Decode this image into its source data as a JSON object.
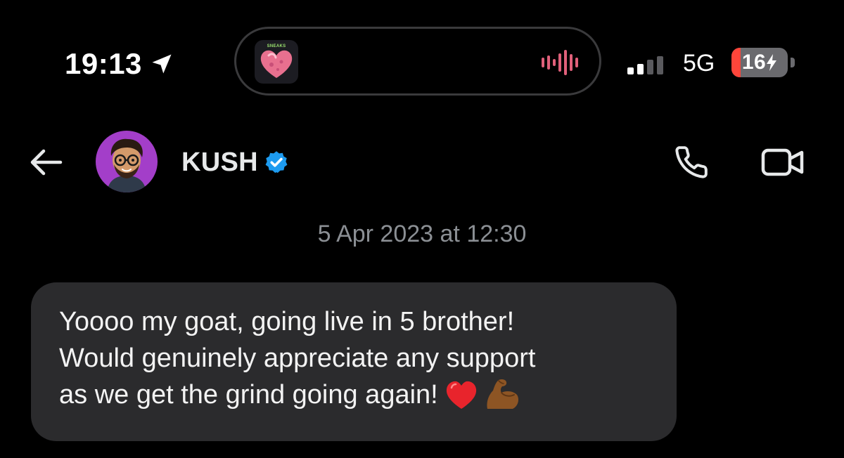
{
  "status_bar": {
    "time": "19:13",
    "network": "5G",
    "battery_level": "16",
    "battery_fraction": 0.16,
    "battery_charging": true,
    "signal_bars_active": 2,
    "signal_bars_total": 4,
    "island_app_label": "SNEAKS",
    "icons": {
      "location": "location-arrow-icon",
      "waveform": "audio-waveform-icon",
      "signal": "cellular-signal-icon",
      "bolt": "charging-bolt-icon"
    }
  },
  "header": {
    "contact_name": "KUSH",
    "verified": true,
    "icons": {
      "back": "back-arrow-icon",
      "call": "phone-icon",
      "video": "video-camera-icon",
      "verified": "verified-badge-icon"
    }
  },
  "conversation": {
    "timestamp": "5 Apr 2023 at 12:30",
    "messages": [
      {
        "sender": "KUSH",
        "lines": [
          "Yoooo my goat, going live in 5 brother!",
          "Would genuinely appreciate any support",
          "as we get the grind going again!"
        ],
        "emojis": [
          "❤️",
          "💪🏾"
        ]
      }
    ]
  },
  "colors": {
    "background": "#000000",
    "bubble": "#2b2b2d",
    "verified_blue": "#1d9bf0",
    "battery_low": "#ff453a",
    "muted_text": "#8b8f94",
    "waveform": "#e0607a",
    "avatar_bg": "#a33ec9"
  }
}
